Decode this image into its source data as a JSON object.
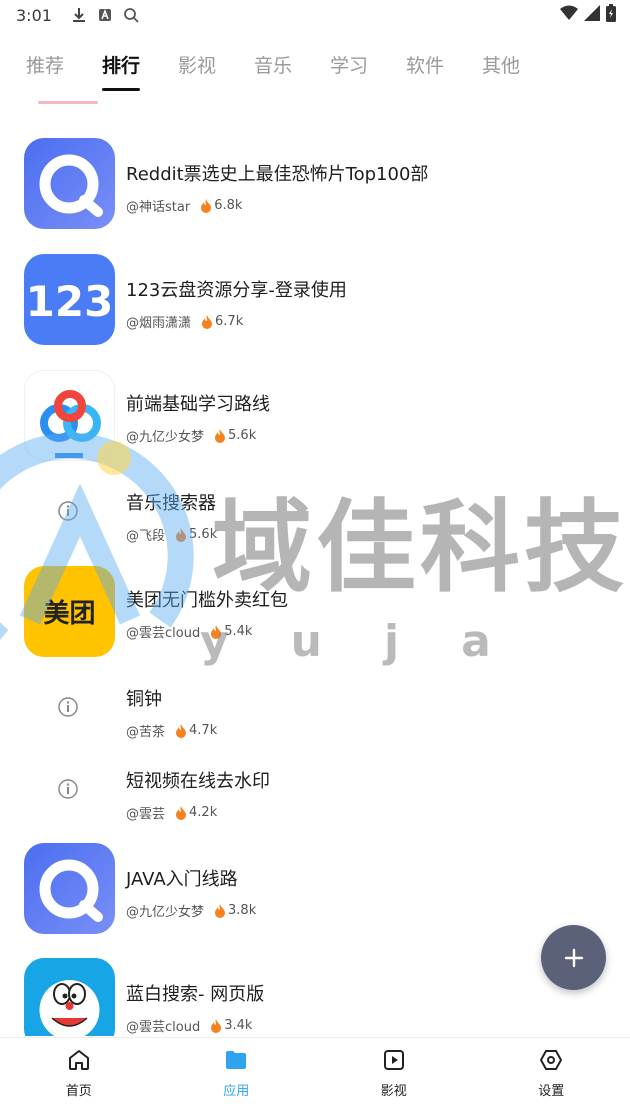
{
  "status_bar": {
    "time": "3:01",
    "icons": [
      "download-icon",
      "a-box-icon",
      "search-icon"
    ],
    "right_icons": [
      "wifi-icon",
      "signal-icon",
      "battery-icon"
    ]
  },
  "tabs": [
    {
      "label": "推荐",
      "active": false
    },
    {
      "label": "排行",
      "active": true
    },
    {
      "label": "影视",
      "active": false
    },
    {
      "label": "音乐",
      "active": false
    },
    {
      "label": "学习",
      "active": false
    },
    {
      "label": "软件",
      "active": false
    },
    {
      "label": "其他",
      "active": false
    }
  ],
  "apps": [
    {
      "title": "Reddit票选史上最佳恐怖片Top100部",
      "author": "@神话star",
      "heat": "6.8k",
      "icon": "browser-ring-icon"
    },
    {
      "title": "123云盘资源分享-登录使用",
      "author": "@烟雨潇潇",
      "heat": "6.7k",
      "icon": "pan123-icon"
    },
    {
      "title": "前端基础学习路线",
      "author": "@九亿少女梦",
      "heat": "5.6k",
      "icon": "baidu-netdisk-icon"
    },
    {
      "title": "音乐搜索器",
      "author": "@飞段",
      "heat": "5.6k",
      "icon": "info-icon"
    },
    {
      "title": "美团无门槛外卖红包",
      "author": "@雲芸cloud",
      "heat": "5.4k",
      "icon": "meituan-icon"
    },
    {
      "title": "铜钟",
      "author": "@苦茶",
      "heat": "4.7k",
      "icon": "info-icon"
    },
    {
      "title": "短视频在线去水印",
      "author": "@雲芸",
      "heat": "4.2k",
      "icon": "info-icon"
    },
    {
      "title": "JAVA入门线路",
      "author": "@九亿少女梦",
      "heat": "3.8k",
      "icon": "browser-ring-icon"
    },
    {
      "title": "蓝白搜索- 网页版",
      "author": "@雲芸cloud",
      "heat": "3.4k",
      "icon": "doraemon-icon"
    }
  ],
  "icon_labels": {
    "pan123": "123",
    "meituan": "美团"
  },
  "watermark": {
    "text": "域佳科技",
    "sub": "yuja"
  },
  "bottom_nav": [
    {
      "label": "首页",
      "icon": "home-icon",
      "active": false
    },
    {
      "label": "应用",
      "icon": "folder-icon",
      "active": true
    },
    {
      "label": "影视",
      "icon": "play-icon",
      "active": false
    },
    {
      "label": "设置",
      "icon": "settings-hex-icon",
      "active": false
    }
  ],
  "colors": {
    "accent": "#2ea3f2",
    "fab": "#5b6179",
    "browser_icon": "#5a7cf4",
    "pan123_icon": "#4a7df5",
    "meituan_icon": "#ffc300",
    "doraemon_icon": "#17a5e5"
  }
}
